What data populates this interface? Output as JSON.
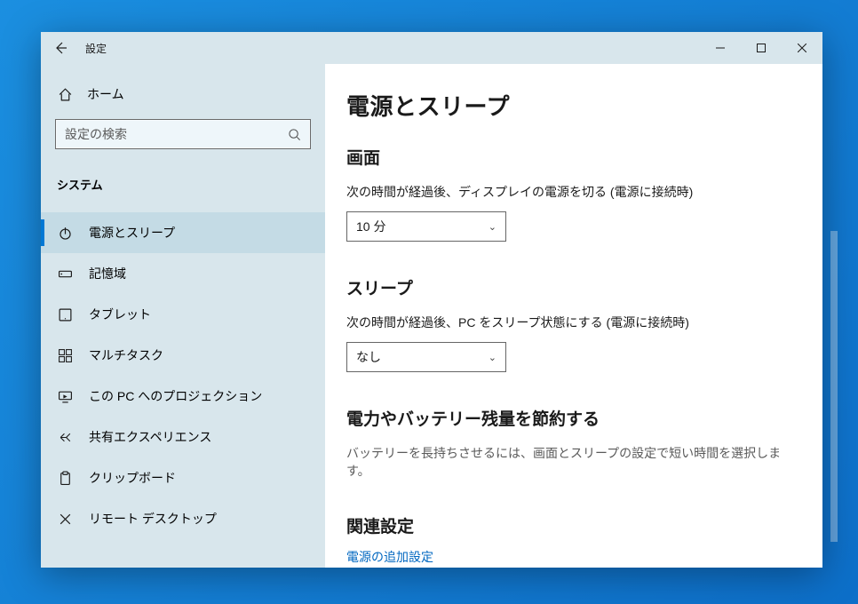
{
  "app": {
    "title": "設定"
  },
  "sidebar": {
    "home_label": "ホーム",
    "search_placeholder": "設定の検索",
    "category_label": "システム",
    "items": [
      {
        "label": "電源とスリープ",
        "icon": "power-icon",
        "active": true
      },
      {
        "label": "記憶域",
        "icon": "storage-icon",
        "active": false
      },
      {
        "label": "タブレット",
        "icon": "tablet-icon",
        "active": false
      },
      {
        "label": "マルチタスク",
        "icon": "multitask-icon",
        "active": false
      },
      {
        "label": "この PC へのプロジェクション",
        "icon": "projection-icon",
        "active": false
      },
      {
        "label": "共有エクスペリエンス",
        "icon": "shared-experiences-icon",
        "active": false
      },
      {
        "label": "クリップボード",
        "icon": "clipboard-icon",
        "active": false
      },
      {
        "label": "リモート デスクトップ",
        "icon": "remote-desktop-icon",
        "active": false
      }
    ]
  },
  "page": {
    "title": "電源とスリープ",
    "section_screen": "画面",
    "screen_label": "次の時間が経過後、ディスプレイの電源を切る (電源に接続時)",
    "screen_value": "10 分",
    "section_sleep": "スリープ",
    "sleep_label": "次の時間が経過後、PC をスリープ状態にする (電源に接続時)",
    "sleep_value": "なし",
    "section_save": "電力やバッテリー残量を節約する",
    "save_desc": "バッテリーを長持ちさせるには、画面とスリープの設定で短い時間を選択します。",
    "section_related": "関連設定",
    "related_link": "電源の追加設定"
  }
}
